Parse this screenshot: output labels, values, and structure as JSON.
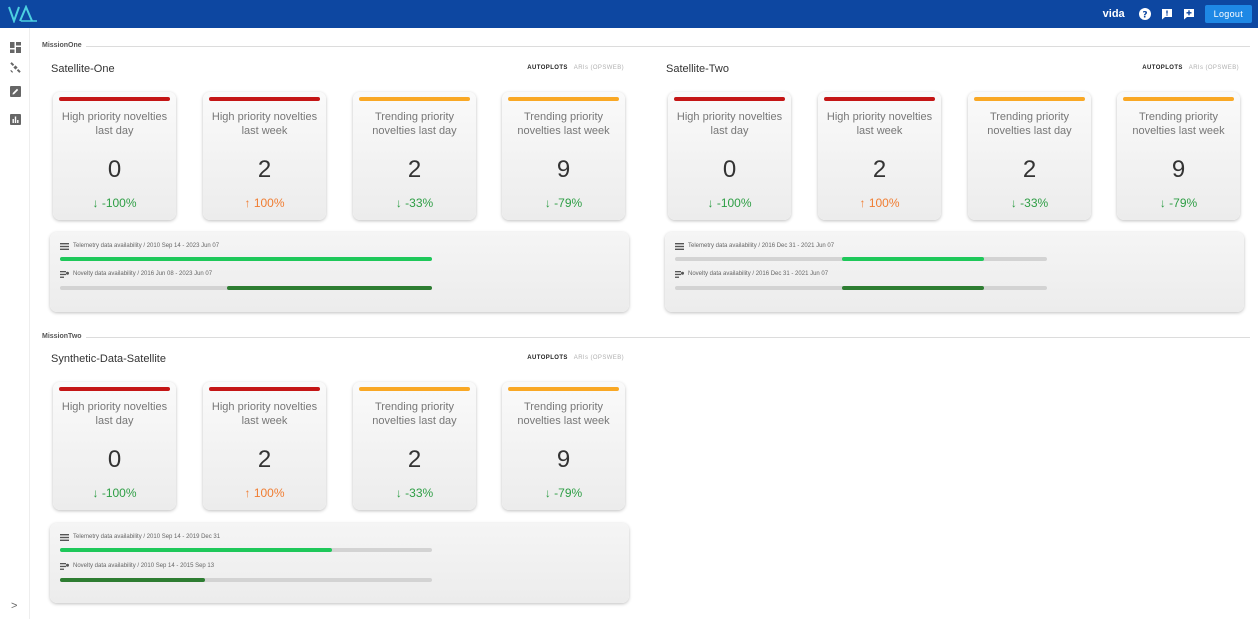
{
  "app": {
    "logo_text": "VIDA",
    "user": "vida",
    "logout_label": "Logout",
    "brand_color": "#0d47a1"
  },
  "sidebar": {
    "icons": [
      "dashboard-icon",
      "satellite-icon",
      "edit-note-icon",
      "chart-icon"
    ],
    "expand_label": ">"
  },
  "colors": {
    "high_priority": "#c41616",
    "trending": "#f9a825",
    "down_change": "#2e9e45",
    "up_change": "#f07d32",
    "telemetry_bar": "#1ec85a",
    "novelty_bar": "#2e7d32"
  },
  "missions": [
    {
      "name": "MissionOne",
      "satellites": [
        {
          "name": "Satellite-One",
          "tabs": {
            "active": "AUTOPLOTS",
            "inactive": "ARIs (OPSWEB)"
          },
          "cards": [
            {
              "title": "High priority novelties last day",
              "value": "0",
              "change": "↓ -100%",
              "priority": "high",
              "direction": "down"
            },
            {
              "title": "High priority novelties last week",
              "value": "2",
              "change": "↑ 100%",
              "priority": "high",
              "direction": "up"
            },
            {
              "title": "Trending priority novelties last day",
              "value": "2",
              "change": "↓ -33%",
              "priority": "trending",
              "direction": "down"
            },
            {
              "title": "Trending priority novelties last week",
              "value": "9",
              "change": "↓ -79%",
              "priority": "trending",
              "direction": "down"
            }
          ],
          "availability": {
            "telemetry": {
              "label": "Telemetry data availability / 2010 Sep 14 - 2023 Jun 07",
              "fill_start": 0.0,
              "fill_end": 1.0
            },
            "novelty": {
              "label": "Novelty data availability / 2016 Jun 08 - 2023 Jun 07",
              "fill_start": 0.45,
              "fill_end": 1.0
            }
          }
        },
        {
          "name": "Satellite-Two",
          "tabs": {
            "active": "AUTOPLOTS",
            "inactive": "ARIs (OPSWEB)"
          },
          "cards": [
            {
              "title": "High priority novelties last day",
              "value": "0",
              "change": "↓ -100%",
              "priority": "high",
              "direction": "down"
            },
            {
              "title": "High priority novelties last week",
              "value": "2",
              "change": "↑ 100%",
              "priority": "high",
              "direction": "up"
            },
            {
              "title": "Trending priority novelties last day",
              "value": "2",
              "change": "↓ -33%",
              "priority": "trending",
              "direction": "down"
            },
            {
              "title": "Trending priority novelties last week",
              "value": "9",
              "change": "↓ -79%",
              "priority": "trending",
              "direction": "down"
            }
          ],
          "availability": {
            "telemetry": {
              "label": "Telemetry data availability / 2016 Dec 31 - 2021 Jun 07",
              "fill_start": 0.45,
              "fill_end": 0.83
            },
            "novelty": {
              "label": "Novelty data availability / 2016 Dec 31 - 2021 Jun 07",
              "fill_start": 0.45,
              "fill_end": 0.83
            }
          }
        }
      ]
    },
    {
      "name": "MissionTwo",
      "satellites": [
        {
          "name": "Synthetic-Data-Satellite",
          "tabs": {
            "active": "AUTOPLOTS",
            "inactive": "ARIs (OPSWEB)"
          },
          "cards": [
            {
              "title": "High priority novelties last day",
              "value": "0",
              "change": "↓ -100%",
              "priority": "high",
              "direction": "down"
            },
            {
              "title": "High priority novelties last week",
              "value": "2",
              "change": "↑ 100%",
              "priority": "high",
              "direction": "up"
            },
            {
              "title": "Trending priority novelties last day",
              "value": "2",
              "change": "↓ -33%",
              "priority": "trending",
              "direction": "down"
            },
            {
              "title": "Trending priority novelties last week",
              "value": "9",
              "change": "↓ -79%",
              "priority": "trending",
              "direction": "down"
            }
          ],
          "availability": {
            "telemetry": {
              "label": "Telemetry data availability / 2010 Sep 14 - 2019 Dec 31",
              "fill_start": 0.0,
              "fill_end": 0.73
            },
            "novelty": {
              "label": "Novelty data availability / 2010 Sep 14 - 2015 Sep 13",
              "fill_start": 0.0,
              "fill_end": 0.39
            }
          }
        }
      ]
    }
  ]
}
